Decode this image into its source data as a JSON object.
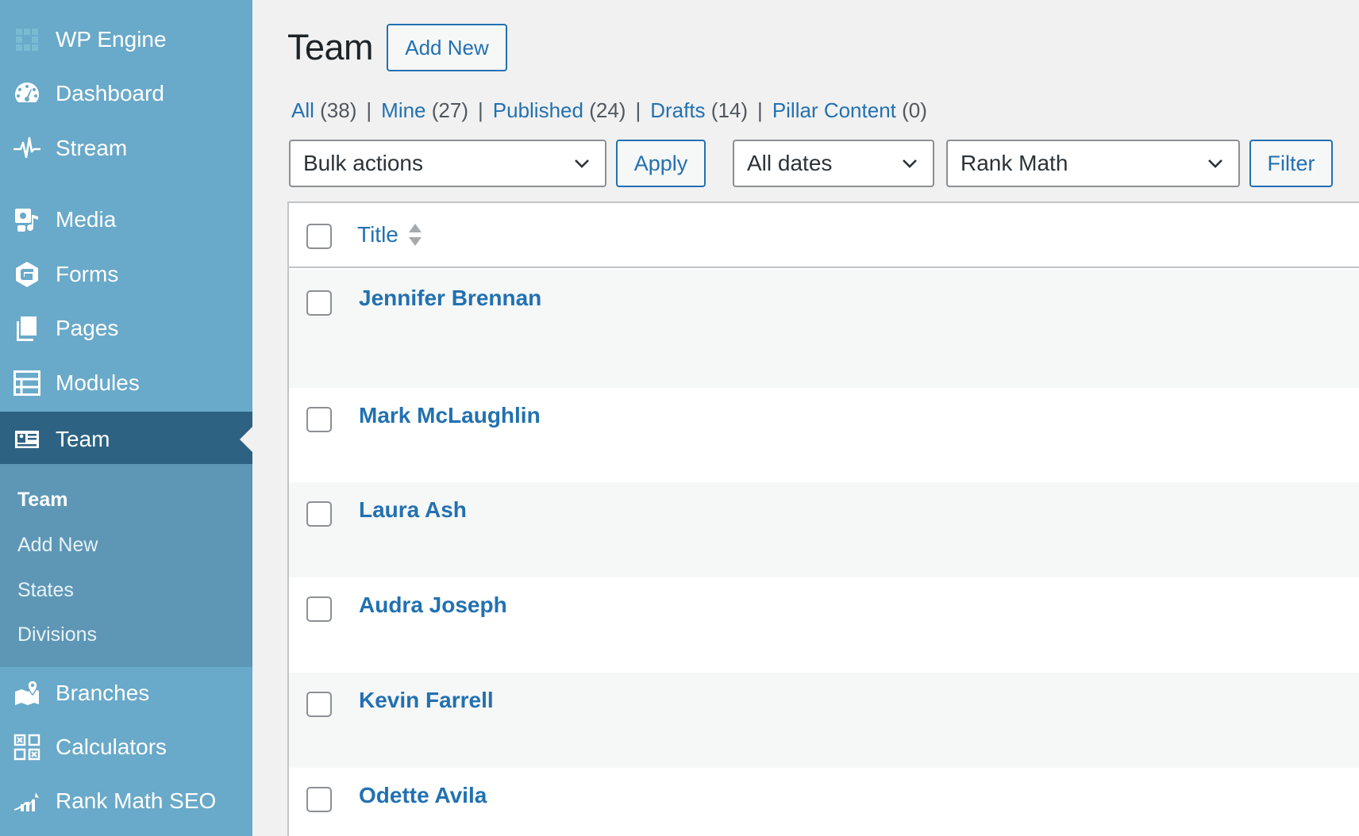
{
  "sidebar": {
    "items": [
      {
        "key": "wpengine",
        "label": "WP Engine",
        "icon": "wp-engine-icon"
      },
      {
        "key": "dashboard",
        "label": "Dashboard",
        "icon": "dashboard-icon"
      },
      {
        "key": "stream",
        "label": "Stream",
        "icon": "pulse-icon"
      },
      {
        "key": "media",
        "label": "Media",
        "icon": "media-icon"
      },
      {
        "key": "forms",
        "label": "Forms",
        "icon": "forms-icon"
      },
      {
        "key": "pages",
        "label": "Pages",
        "icon": "pages-icon"
      },
      {
        "key": "modules",
        "label": "Modules",
        "icon": "modules-icon"
      },
      {
        "key": "team",
        "label": "Team",
        "icon": "id-card-icon",
        "current": true
      },
      {
        "key": "branches",
        "label": "Branches",
        "icon": "map-pin-icon"
      },
      {
        "key": "calculators",
        "label": "Calculators",
        "icon": "calculator-icon"
      },
      {
        "key": "rankmath",
        "label": "Rank Math SEO",
        "icon": "chart-icon"
      }
    ],
    "submenu": [
      {
        "label": "Team",
        "active": true
      },
      {
        "label": "Add New"
      },
      {
        "label": "States"
      },
      {
        "label": "Divisions"
      }
    ]
  },
  "header": {
    "title": "Team",
    "add_new_label": "Add New"
  },
  "views": [
    {
      "label": "All",
      "count": "(38)"
    },
    {
      "label": "Mine",
      "count": "(27)"
    },
    {
      "label": "Published",
      "count": "(24)"
    },
    {
      "label": "Drafts",
      "count": "(14)"
    },
    {
      "label": "Pillar Content",
      "count": "(0)"
    }
  ],
  "toolbar": {
    "bulk_actions": "Bulk actions",
    "apply_label": "Apply",
    "dates": "All dates",
    "rank_math": "Rank Math",
    "filter_label": "Filter"
  },
  "table": {
    "title_header": "Title",
    "rows": [
      {
        "name": "Jennifer Brennan"
      },
      {
        "name": "Mark McLaughlin"
      },
      {
        "name": "Laura Ash"
      },
      {
        "name": "Audra Joseph"
      },
      {
        "name": "Kevin Farrell"
      },
      {
        "name": "Odette Avila"
      }
    ]
  },
  "colors": {
    "sidebar_bg": "#69a9c9",
    "sidebar_current": "#2e6283",
    "submenu_bg": "#5e97b5",
    "link": "#2271b1"
  }
}
